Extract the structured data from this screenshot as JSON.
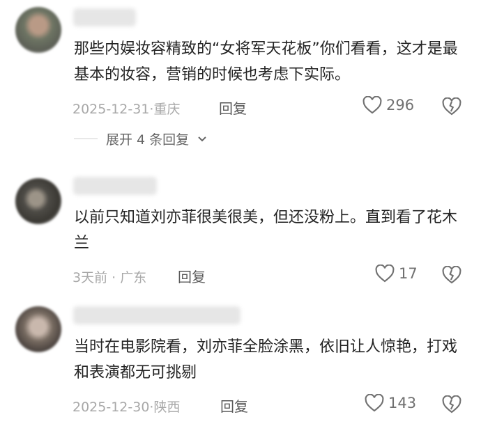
{
  "comments": [
    {
      "text": "那些内娱妆容精致的“女将军天花板”你们看看，这才是最基本的妆容，营销的时候也考虑下实际。",
      "date": "2025-12-31·重庆",
      "reply_label": "回复",
      "likes": "296",
      "expand_label": "展开 4 条回复"
    },
    {
      "text": "以前只知道刘亦菲很美很美，但还没粉上。直到看了花木兰",
      "date": "3天前 · 广东",
      "reply_label": "回复",
      "likes": "17"
    },
    {
      "text": "当时在电影院看，刘亦菲全脸涂黑，依旧让人惊艳，打戏和表演都无可挑剔",
      "date": "2025-12-30·陕西",
      "reply_label": "回复",
      "likes": "143"
    }
  ],
  "icons": {
    "like": "heart-outline-icon",
    "dislike": "broken-heart-icon",
    "expand": "chevron-down-icon"
  },
  "colors": {
    "text": "#232323",
    "meta": "#a8a8a8",
    "icon": "#707070"
  }
}
